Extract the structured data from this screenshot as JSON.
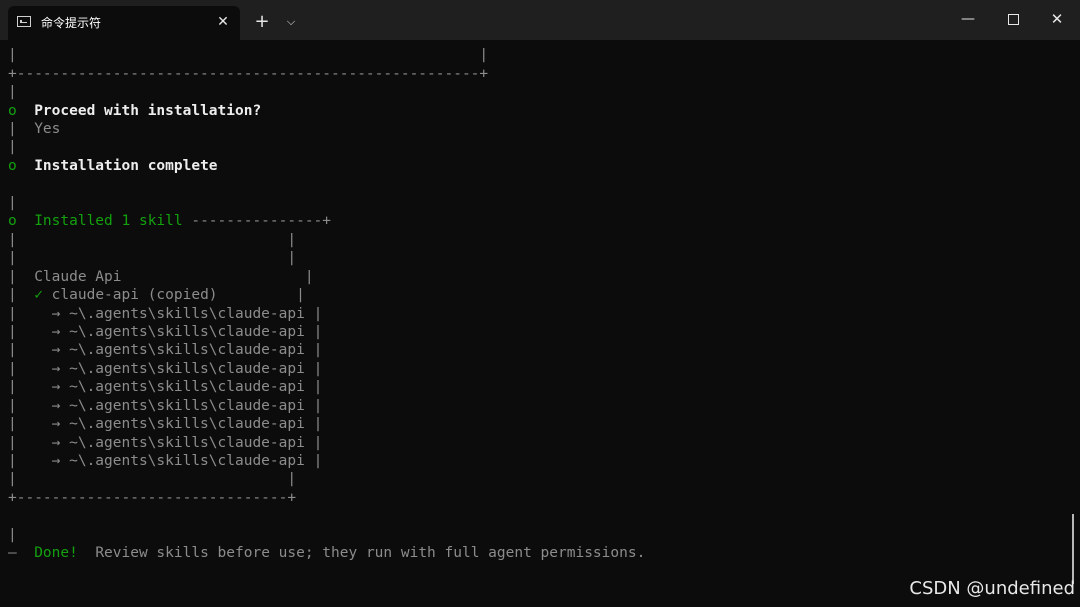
{
  "window": {
    "tab_title": "命令提示符",
    "tab_close": "✕",
    "new_tab": "+",
    "dropdown": "⌵",
    "minimize": "—",
    "close": "✕"
  },
  "terminal": {
    "top_bar": "|                                                     |",
    "top_border": "+-----------------------------------------------------+",
    "bar": "|",
    "q1_marker": "o",
    "q1_text": "Proceed with installation?",
    "answer_bar": "|",
    "answer": "Yes",
    "status_marker": "o",
    "status_text": "Installation complete",
    "installed_marker": "o",
    "installed_text": "Installed 1 skill",
    "installed_rule": " ---------------+",
    "box_empty": "|                               |",
    "box_right": "|",
    "skill_name": "Claude Api",
    "check": "✓",
    "skill_entry": "claude-api (copied)",
    "paths": [
      "→ ~\\.agents\\skills\\claude-api",
      "→ ~\\.agents\\skills\\claude-api",
      "→ ~\\.agents\\skills\\claude-api",
      "→ ~\\.agents\\skills\\claude-api",
      "→ ~\\.agents\\skills\\claude-api",
      "→ ~\\.agents\\skills\\claude-api",
      "→ ~\\.agents\\skills\\claude-api",
      "→ ~\\.agents\\skills\\claude-api",
      "→ ~\\.agents\\skills\\claude-api"
    ],
    "bottom_border": "+-------------------------------+",
    "done_marker": "—",
    "done_label": "Done!",
    "done_text": "Review skills before use; they run with full agent permissions."
  },
  "watermark": "CSDN @undefined"
}
